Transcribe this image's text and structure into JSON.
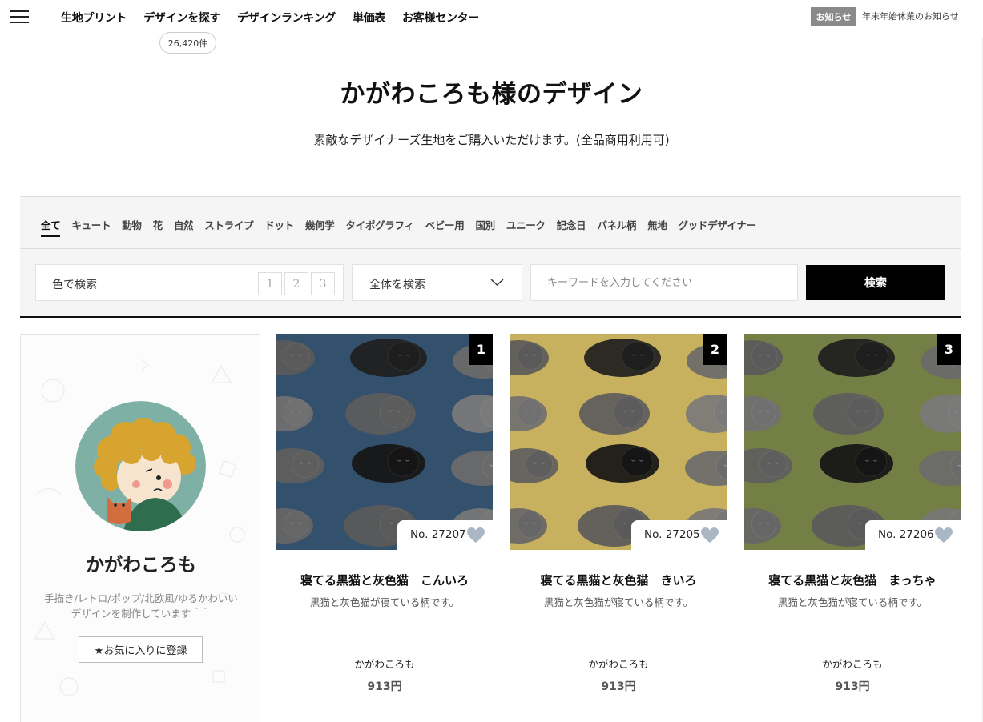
{
  "header": {
    "nav": [
      "生地プリント",
      "デザインを探す",
      "デザインランキング",
      "単価表",
      "お客様センター"
    ],
    "design_count": "26,420件",
    "notice_label": "お知らせ",
    "notice_text": "年末年始休業のお知らせ"
  },
  "page": {
    "title": "かがわころも様のデザイン",
    "subtitle": "素敵なデザイナーズ生地をご購入いただけます。(全品商用利用可)"
  },
  "filters": {
    "categories": [
      "全て",
      "キュート",
      "動物",
      "花",
      "自然",
      "ストライプ",
      "ドット",
      "幾何学",
      "タイポグラフィ",
      "ベビー用",
      "国別",
      "ユニーク",
      "記念日",
      "パネル柄",
      "無地",
      "グッドデザイナー"
    ],
    "active_category": "全て",
    "color_search_label": "色で検索",
    "color_pages": [
      "1",
      "2",
      "3"
    ],
    "scope_value": "全体を検索",
    "keyword_placeholder": "キーワードを入力してください",
    "search_button": "検索"
  },
  "designer": {
    "name": "かがわころも",
    "description_line1": "手描き/レトロ/ポップ/北欧風/ゆるかわいい",
    "description_line2": "デザインを制作しています＾＾",
    "favorite_button": "★お気に入りに登録"
  },
  "products": [
    {
      "rank": "1",
      "number": "No. 27207",
      "name": "寝てる黒猫と灰色猫　こんいろ",
      "description": "黒猫と灰色猫が寝ている柄です。",
      "designer": "かがわころも",
      "price": "913円",
      "bg_color": "#33506c"
    },
    {
      "rank": "2",
      "number": "No. 27205",
      "name": "寝てる黒猫と灰色猫　きいろ",
      "description": "黒猫と灰色猫が寝ている柄です。",
      "designer": "かがわころも",
      "price": "913円",
      "bg_color": "#c7b15f"
    },
    {
      "rank": "3",
      "number": "No. 27206",
      "name": "寝てる黒猫と灰色猫　まっちゃ",
      "description": "黒猫と灰色猫が寝ている柄です。",
      "designer": "かがわころも",
      "price": "913円",
      "bg_color": "#737f45"
    }
  ],
  "colors": {
    "heart": "#a9b6c4",
    "avatar_bg": "#7fb0a6"
  }
}
